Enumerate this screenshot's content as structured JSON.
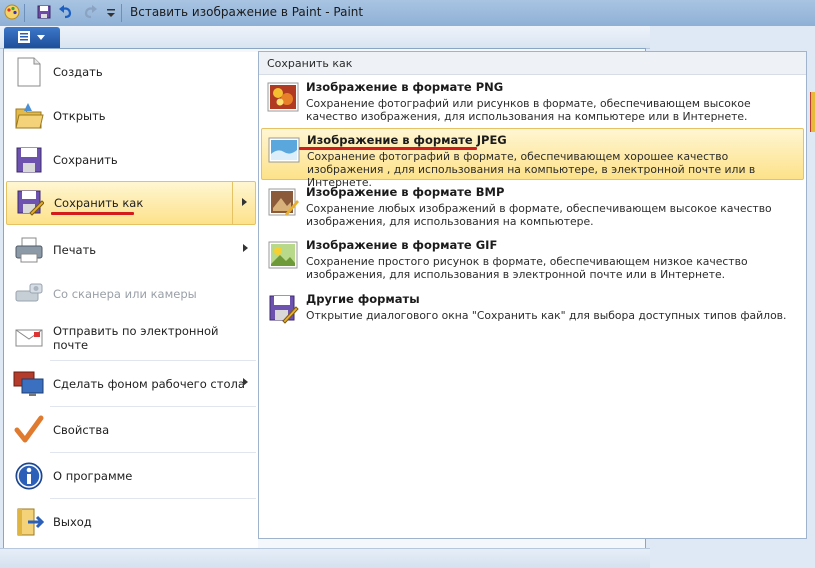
{
  "window": {
    "title": "Вставить изображение в Paint - Paint"
  },
  "quick_access": [
    "paint-app-icon",
    "save-icon",
    "undo-icon",
    "redo-icon",
    "customize-dropdown-icon"
  ],
  "file_menu": {
    "items": [
      {
        "label": "Создать",
        "icon": "new-document-icon",
        "disabled": false,
        "submenu": false
      },
      {
        "label": "Открыть",
        "icon": "open-folder-icon",
        "disabled": false,
        "submenu": false
      },
      {
        "label": "Сохранить",
        "icon": "save-icon",
        "disabled": false,
        "submenu": false
      },
      {
        "label": "Сохранить как",
        "icon": "save-as-icon",
        "disabled": false,
        "submenu": true,
        "selected": true
      },
      {
        "label": "Печать",
        "icon": "printer-icon",
        "disabled": false,
        "submenu": true
      },
      {
        "label": "Со сканера или камеры",
        "icon": "scanner-icon",
        "disabled": true,
        "submenu": false
      },
      {
        "label": "Отправить по электронной почте",
        "icon": "email-icon",
        "disabled": false,
        "submenu": false
      },
      {
        "label": "Сделать фоном рабочего стола",
        "icon": "desktop-background-icon",
        "disabled": false,
        "submenu": true
      },
      {
        "label": "Свойства",
        "icon": "checkmark-icon",
        "disabled": false,
        "submenu": false
      },
      {
        "label": "О программе",
        "icon": "info-icon",
        "disabled": false,
        "submenu": false
      },
      {
        "label": "Выход",
        "icon": "exit-icon",
        "disabled": false,
        "submenu": false
      }
    ]
  },
  "save_as": {
    "header": "Сохранить как",
    "items": [
      {
        "title": "Изображение в формате PNG",
        "desc": "Сохранение фотографий или рисунков в формате, обеспечивающем высокое качество изображения, для использования на компьютере или в Интернете.",
        "icon": "png-format-icon"
      },
      {
        "title": "Изображение в формате JPEG",
        "desc": "Сохранение фотографий в формате, обеспечивающем хорошее качество изображения , для использования на компьютере, в электронной почте или в Интернете.",
        "icon": "jpeg-format-icon",
        "selected": true
      },
      {
        "title": "Изображение в формате BMP",
        "desc": "Сохранение любых изображений в формате, обеспечивающем высокое качество изображения, для использования на компьютере.",
        "icon": "bmp-format-icon"
      },
      {
        "title": "Изображение в формате GIF",
        "desc": "Сохранение простого рисунок в формате, обеспечивающем низкое качество изображения, для использования в электронной почте или в Интернете.",
        "icon": "gif-format-icon"
      },
      {
        "title": "Другие форматы",
        "desc": "Открытие диалогового окна \"Сохранить как\" для выбора доступных типов файлов.",
        "icon": "other-formats-icon"
      }
    ]
  },
  "colors": {
    "highlight_top": "#fff6d2",
    "highlight_bottom": "#fde28a",
    "annotation_red": "#d31b1b",
    "file_button": "#2a5fb0"
  }
}
